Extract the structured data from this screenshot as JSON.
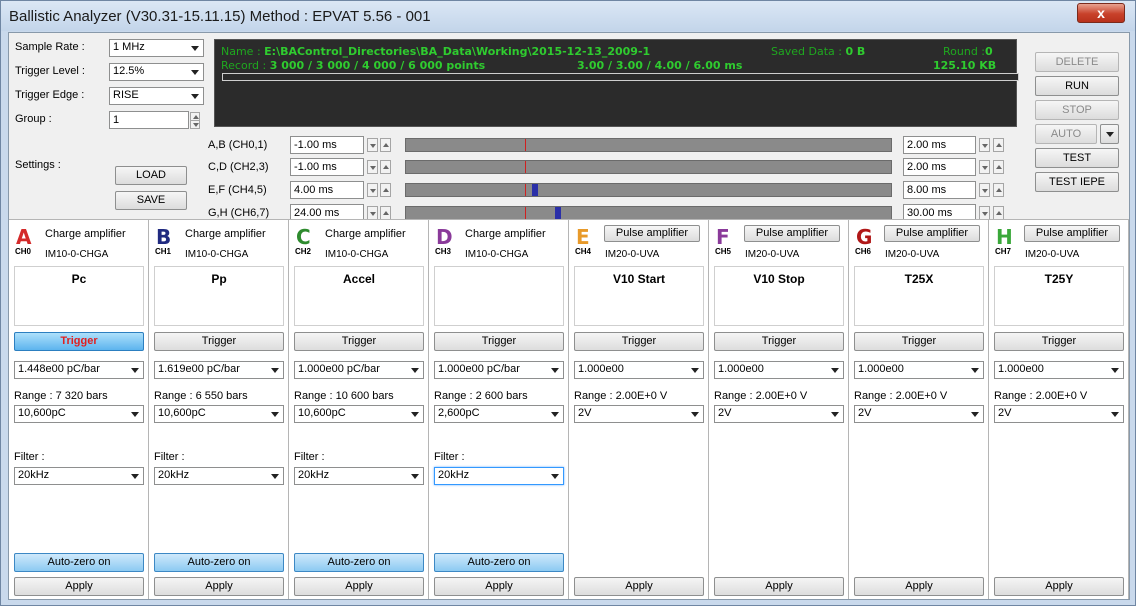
{
  "window": {
    "title": "Ballistic Analyzer (V30.31-15.11.15)   Method : EPVAT 5.56 - 001",
    "close_label": "x"
  },
  "settings": {
    "sample_rate_label": "Sample Rate :",
    "sample_rate_value": "1 MHz",
    "trigger_level_label": "Trigger Level :",
    "trigger_level_value": "12.5%",
    "trigger_edge_label": "Trigger Edge :",
    "trigger_edge_value": "RISE",
    "group_label": "Group :",
    "group_value": "1",
    "settings_label": "Settings :",
    "load_label": "LOAD",
    "save_label": "SAVE"
  },
  "info": {
    "name_label": "Name :",
    "name_value": "E:\\BAControl_Directories\\BA_Data\\Working\\2015-12-13_2009-1",
    "saved_label": "Saved Data :",
    "saved_value": "0 B",
    "round_label": "Round :",
    "round_value": "0",
    "record_label": "Record :",
    "record_value": "3 000 / 3 000 / 4 000 / 6 000 points",
    "record_ms": "3.00 /  3.00 /  4.00 /  6.00 ms",
    "size_value": "125.10 KB",
    "progress": 0
  },
  "channel_pairs": [
    {
      "label": "A,B (CH0,1)",
      "start": "-1.00 ms",
      "end": "2.00 ms"
    },
    {
      "label": "C,D (CH2,3)",
      "start": "-1.00 ms",
      "end": "2.00 ms"
    },
    {
      "label": "E,F (CH4,5)",
      "start": "4.00 ms",
      "end": "8.00 ms"
    },
    {
      "label": "G,H (CH6,7)",
      "start": "24.00 ms",
      "end": "30.00 ms"
    }
  ],
  "actions": {
    "delete": "DELETE",
    "run": "RUN",
    "stop": "STOP",
    "auto": "AUTO",
    "test": "TEST",
    "test_iepe": "TEST IEPE"
  },
  "channels": [
    {
      "letter": "A",
      "id": "CH0",
      "color": "#d42a2a",
      "type": "Charge amplifier",
      "type_is_button": false,
      "model": "IM10-0-CHGA",
      "name": "Pc",
      "trigger": "Trigger",
      "trigger_active": true,
      "sensitivity": "1.448e00 pC/bar",
      "range_label": "Range :  7 320 bars",
      "range_value": "10,600pC",
      "filter_label": "Filter :",
      "filter_value": "20kHz",
      "autozero": "Auto-zero on",
      "apply": "Apply"
    },
    {
      "letter": "B",
      "id": "CH1",
      "color": "#202a80",
      "type": "Charge amplifier",
      "type_is_button": false,
      "model": "IM10-0-CHGA",
      "name": "Pp",
      "trigger": "Trigger",
      "trigger_active": false,
      "sensitivity": "1.619e00 pC/bar",
      "range_label": "Range :  6 550 bars",
      "range_value": "10,600pC",
      "filter_label": "Filter :",
      "filter_value": "20kHz",
      "autozero": "Auto-zero on",
      "apply": "Apply"
    },
    {
      "letter": "C",
      "id": "CH2",
      "color": "#2e8b2e",
      "type": "Charge amplifier",
      "type_is_button": false,
      "model": "IM10-0-CHGA",
      "name": "Accel",
      "trigger": "Trigger",
      "trigger_active": false,
      "sensitivity": "1.000e00 pC/bar",
      "range_label": "Range :  10 600 bars",
      "range_value": "10,600pC",
      "filter_label": "Filter :",
      "filter_value": "20kHz",
      "autozero": "Auto-zero on",
      "apply": "Apply"
    },
    {
      "letter": "D",
      "id": "CH3",
      "color": "#8a3a9a",
      "type": "Charge amplifier",
      "type_is_button": false,
      "model": "IM10-0-CHGA",
      "name": "",
      "trigger": "Trigger",
      "trigger_active": false,
      "sensitivity": "1.000e00 pC/bar",
      "range_label": "Range :  2 600 bars",
      "range_value": "2,600pC",
      "filter_label": "Filter :",
      "filter_value": "20kHz",
      "autozero": "Auto-zero on",
      "apply": "Apply"
    },
    {
      "letter": "E",
      "id": "CH4",
      "color": "#e89a2a",
      "type": "Pulse amplifier",
      "type_is_button": true,
      "model": "IM20-0-UVA",
      "name": "V10 Start",
      "trigger": "Trigger",
      "trigger_active": false,
      "sensitivity": "1.000e00",
      "range_label": "Range : 2.00E+0 V",
      "range_value": "2V",
      "filter_label": "",
      "filter_value": "",
      "autozero": "",
      "apply": "Apply"
    },
    {
      "letter": "F",
      "id": "CH5",
      "color": "#8a3a9a",
      "type": "Pulse amplifier",
      "type_is_button": true,
      "model": "IM20-0-UVA",
      "name": "V10 Stop",
      "trigger": "Trigger",
      "trigger_active": false,
      "sensitivity": "1.000e00",
      "range_label": "Range : 2.00E+0 V",
      "range_value": "2V",
      "filter_label": "",
      "filter_value": "",
      "autozero": "",
      "apply": "Apply"
    },
    {
      "letter": "G",
      "id": "CH6",
      "color": "#b01818",
      "type": "Pulse amplifier",
      "type_is_button": true,
      "model": "IM20-0-UVA",
      "name": "T25X",
      "trigger": "Trigger",
      "trigger_active": false,
      "sensitivity": "1.000e00",
      "range_label": "Range : 2.00E+0 V",
      "range_value": "2V",
      "filter_label": "",
      "filter_value": "",
      "autozero": "",
      "apply": "Apply"
    },
    {
      "letter": "H",
      "id": "CH7",
      "color": "#3aa83a",
      "type": "Pulse amplifier",
      "type_is_button": true,
      "model": "IM20-0-UVA",
      "name": "T25Y",
      "trigger": "Trigger",
      "trigger_active": false,
      "sensitivity": "1.000e00",
      "range_label": "Range : 2.00E+0 V",
      "range_value": "2V",
      "filter_label": "",
      "filter_value": "",
      "autozero": "",
      "apply": "Apply"
    }
  ]
}
